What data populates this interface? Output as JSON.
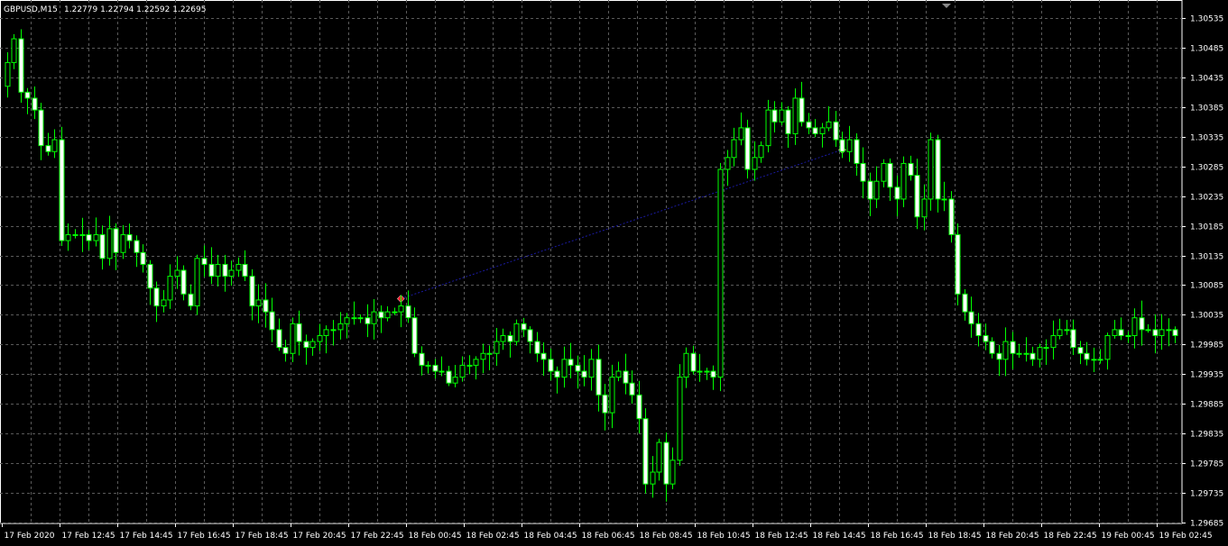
{
  "chart_header": {
    "symbol_timeframe": "GBPUSD,M15",
    "ohlc": "1.22779 1.22794 1.22592 1.22695"
  },
  "colors": {
    "background": "#000000",
    "grid": "#5a5a5a",
    "candle": "#00ff00",
    "axis_text": "#ffffff",
    "trend_line": "#1a1aa0",
    "marker_start": "#ff2a2a",
    "marker_end": "#ffc000"
  },
  "chart_data": {
    "type": "candlestick",
    "price_ticks": [
      "1.30535",
      "1.30485",
      "1.30435",
      "1.30385",
      "1.30335",
      "1.30285",
      "1.30235",
      "1.30185",
      "1.30135",
      "1.30085",
      "1.30035",
      "1.29985",
      "1.29935",
      "1.29885",
      "1.29835",
      "1.29785",
      "1.29735",
      "1.29685"
    ],
    "time_ticks": [
      "17 Feb 2020",
      "17 Feb 12:45",
      "17 Feb 14:45",
      "17 Feb 16:45",
      "17 Feb 18:45",
      "17 Feb 20:45",
      "17 Feb 22:45",
      "18 Feb 00:45",
      "18 Feb 02:45",
      "18 Feb 04:45",
      "18 Feb 06:45",
      "18 Feb 08:45",
      "18 Feb 10:45",
      "18 Feb 12:45",
      "18 Feb 14:45",
      "18 Feb 16:45",
      "18 Feb 18:45",
      "18 Feb 20:45",
      "18 Feb 22:45",
      "19 Feb 00:45",
      "19 Feb 02:45"
    ],
    "ylim": [
      1.29685,
      1.30535
    ],
    "close": [
      1.3046,
      1.305,
      1.3041,
      1.304,
      1.3038,
      1.3032,
      1.3031,
      1.3033,
      1.3016,
      1.3017,
      1.3017,
      1.3017,
      1.3016,
      1.3017,
      1.3013,
      1.3018,
      1.3014,
      1.3017,
      1.3016,
      1.3014,
      1.3012,
      1.3008,
      1.3005,
      1.3006,
      1.301,
      1.3011,
      1.3007,
      1.3005,
      1.3013,
      1.3012,
      1.301,
      1.3012,
      1.301,
      1.3011,
      1.3012,
      1.301,
      1.3005,
      1.3006,
      1.3004,
      1.3001,
      1.2998,
      1.2997,
      1.3002,
      1.2999,
      1.2998,
      1.2999,
      1.3,
      1.3001,
      1.3001,
      1.3002,
      1.3003,
      1.3003,
      1.3003,
      1.3002,
      1.3004,
      1.3003,
      1.3004,
      1.3004,
      1.3005,
      1.3003,
      1.2997,
      1.2995,
      1.2995,
      1.2994,
      1.2994,
      1.2992,
      1.2993,
      1.2995,
      1.2995,
      1.2996,
      1.2997,
      1.2997,
      1.2999,
      1.3,
      1.2999,
      1.3002,
      1.3001,
      1.2999,
      1.2997,
      1.2996,
      1.2994,
      1.2993,
      1.2996,
      1.2995,
      1.2994,
      1.2993,
      1.2996,
      1.299,
      1.2987,
      1.2993,
      1.2994,
      1.2992,
      1.299,
      1.2986,
      1.2975,
      1.2977,
      1.2982,
      1.2975,
      1.2979,
      1.2993,
      1.2997,
      1.2994,
      1.2994,
      1.2994,
      1.2993,
      1.3028,
      1.303,
      1.3033,
      1.3035,
      1.3028,
      1.303,
      1.3032,
      1.3038,
      1.3036,
      1.3038,
      1.3034,
      1.304,
      1.3036,
      1.3035,
      1.3034,
      1.3035,
      1.3036,
      1.3033,
      1.3031,
      1.3033,
      1.3029,
      1.3026,
      1.3023,
      1.3026,
      1.3029,
      1.3025,
      1.3023,
      1.3029,
      1.3027,
      1.302,
      1.3023,
      1.3033,
      1.3023,
      1.3023,
      1.3017,
      1.3007,
      1.3004,
      1.3002,
      1.3,
      1.2999,
      1.2997,
      1.2996,
      1.2999,
      1.2997,
      1.2997,
      1.2997,
      1.2996,
      1.2998,
      1.2998,
      1.3,
      1.3001,
      1.3001,
      1.2998,
      1.2997,
      1.2996,
      1.2996,
      1.2996,
      1.3,
      1.3001,
      1.3,
      1.3,
      1.3003,
      1.3001,
      1.3001,
      1.3,
      1.3001,
      1.3001,
      1.3
    ]
  },
  "annotations": {
    "trend_line_start_index": 58,
    "trend_line_end_index": 123
  }
}
